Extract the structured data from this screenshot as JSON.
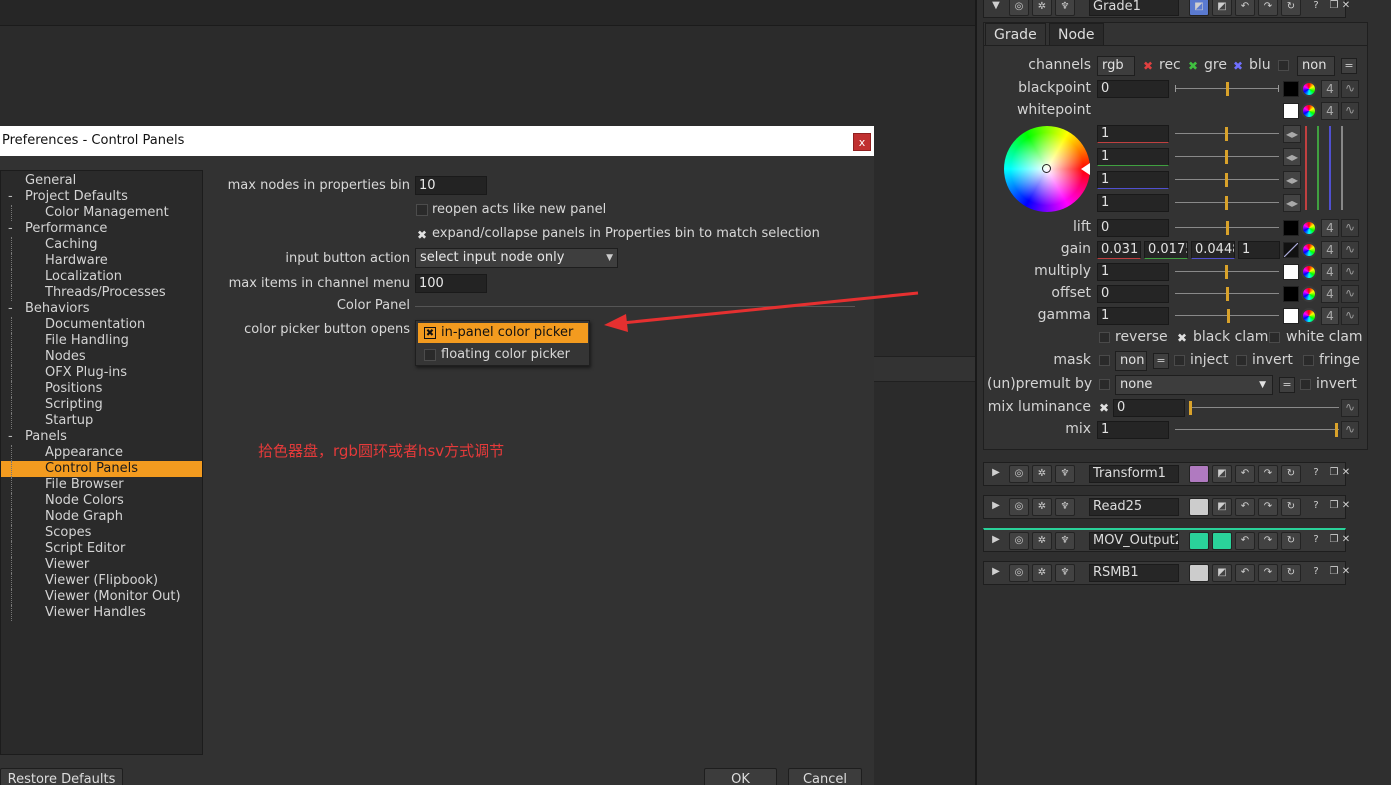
{
  "dialog": {
    "title": "Preferences - Control Panels",
    "close": "x",
    "tree": [
      {
        "label": "General",
        "indent": 0,
        "toggle": ""
      },
      {
        "label": "Project Defaults",
        "indent": 0,
        "toggle": "-"
      },
      {
        "label": "Color Management",
        "indent": 1,
        "toggle": ""
      },
      {
        "label": "Performance",
        "indent": 0,
        "toggle": "-"
      },
      {
        "label": "Caching",
        "indent": 1,
        "toggle": ""
      },
      {
        "label": "Hardware",
        "indent": 1,
        "toggle": ""
      },
      {
        "label": "Localization",
        "indent": 1,
        "toggle": ""
      },
      {
        "label": "Threads/Processes",
        "indent": 1,
        "toggle": ""
      },
      {
        "label": "Behaviors",
        "indent": 0,
        "toggle": "-"
      },
      {
        "label": "Documentation",
        "indent": 1,
        "toggle": ""
      },
      {
        "label": "File Handling",
        "indent": 1,
        "toggle": ""
      },
      {
        "label": "Nodes",
        "indent": 1,
        "toggle": ""
      },
      {
        "label": "OFX Plug-ins",
        "indent": 1,
        "toggle": ""
      },
      {
        "label": "Positions",
        "indent": 1,
        "toggle": ""
      },
      {
        "label": "Scripting",
        "indent": 1,
        "toggle": ""
      },
      {
        "label": "Startup",
        "indent": 1,
        "toggle": ""
      },
      {
        "label": "Panels",
        "indent": 0,
        "toggle": "-"
      },
      {
        "label": "Appearance",
        "indent": 1,
        "toggle": ""
      },
      {
        "label": "Control Panels",
        "indent": 1,
        "toggle": "",
        "selected": true
      },
      {
        "label": "File Browser",
        "indent": 1,
        "toggle": ""
      },
      {
        "label": "Node Colors",
        "indent": 1,
        "toggle": ""
      },
      {
        "label": "Node Graph",
        "indent": 1,
        "toggle": ""
      },
      {
        "label": "Scopes",
        "indent": 1,
        "toggle": ""
      },
      {
        "label": "Script Editor",
        "indent": 1,
        "toggle": ""
      },
      {
        "label": "Viewer",
        "indent": 1,
        "toggle": ""
      },
      {
        "label": "Viewer (Flipbook)",
        "indent": 1,
        "toggle": ""
      },
      {
        "label": "Viewer (Monitor Out)",
        "indent": 1,
        "toggle": ""
      },
      {
        "label": "Viewer Handles",
        "indent": 1,
        "toggle": ""
      }
    ],
    "settings": {
      "max_nodes_label": "max nodes in properties bin",
      "max_nodes_value": "10",
      "reopen_label": "reopen acts like new panel",
      "expand_label": "expand/collapse panels in Properties bin to match selection",
      "expand_check": "✖",
      "input_action_label": "input button action",
      "input_action_value": "select input node only",
      "max_items_label": "max items in channel menu",
      "max_items_value": "100",
      "color_panel_section": "Color Panel",
      "picker_label": "color picker button opens",
      "picker_options": [
        "in-panel color picker",
        "floating color picker"
      ],
      "picker_check": "✖"
    },
    "annotation": "拾色器盘，rgb圆环或者hsv方式调节",
    "restore_button": "Restore Defaults",
    "ok_button": "OK",
    "cancel_button": "Cancel"
  },
  "properties": {
    "grade_node": "Grade1",
    "tabs": [
      "Grade",
      "Node"
    ],
    "channels_label": "channels",
    "channels_value": "rgb",
    "channel_r": "rec",
    "channel_g": "gre",
    "channel_b": "blu",
    "channel_extra": "non",
    "blackpoint_label": "blackpoint",
    "blackpoint_value": "0",
    "whitepoint_label": "whitepoint",
    "whitepoint_values": [
      "1",
      "1",
      "1",
      "1"
    ],
    "lift_label": "lift",
    "lift_value": "0",
    "gain_label": "gain",
    "gain_values": [
      "0.031",
      "0.0175",
      "0.0448",
      "1"
    ],
    "multiply_label": "multiply",
    "multiply_value": "1",
    "offset_label": "offset",
    "offset_value": "0",
    "gamma_label": "gamma",
    "gamma_value": "1",
    "gamma_ticks": [
      "0.2",
      "0.3",
      "1",
      "3.5"
    ],
    "four": "4",
    "reverse_label": "reverse",
    "black_clamp_label": "black clam",
    "white_clamp_label": "white clam",
    "mask_label": "mask",
    "mask_value": "non",
    "inject_label": "inject",
    "invert_label": "invert",
    "fringe_label": "fringe",
    "unpremult_label": "(un)premult by",
    "unpremult_value": "none",
    "invert2_label": "invert",
    "mix_lum_label": "mix luminance",
    "mix_lum_value": "0",
    "mix_label": "mix",
    "mix_value": "1",
    "slider_ticks_a": [
      "-1",
      "0",
      "1"
    ],
    "slider_ticks_b": [
      "0",
      "1",
      "4"
    ],
    "slider_ticks_c": [
      "0",
      "0.2",
      "0.4",
      "0.6",
      "0.8",
      "1"
    ],
    "nodes": [
      "Transform1",
      "Read25",
      "MOV_Output2",
      "RSMB1"
    ]
  }
}
